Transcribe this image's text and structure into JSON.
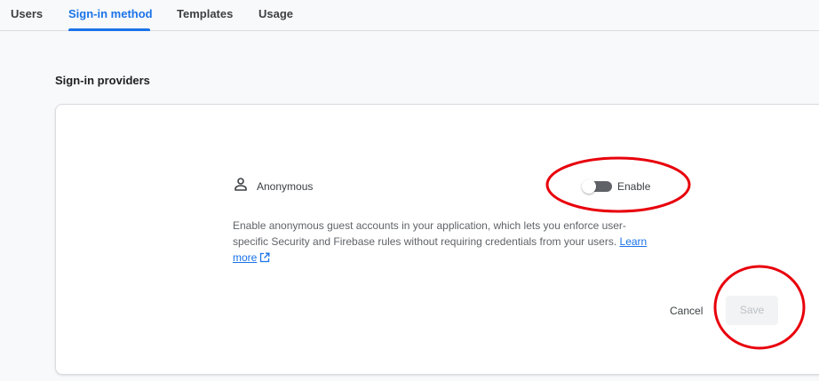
{
  "tabs": [
    {
      "label": "Users",
      "active": false
    },
    {
      "label": "Sign-in method",
      "active": true
    },
    {
      "label": "Templates",
      "active": false
    },
    {
      "label": "Usage",
      "active": false
    }
  ],
  "section": {
    "title": "Sign-in providers"
  },
  "provider": {
    "icon": "person-icon",
    "name": "Anonymous",
    "toggle_label": "Enable",
    "enabled": false,
    "description": "Enable anonymous guest accounts in your application, which lets you enforce user-specific Security and Firebase rules without requiring credentials from your users.",
    "learn_more": "Learn more",
    "learn_more_icon": "open-in-new-icon"
  },
  "actions": {
    "cancel_label": "Cancel",
    "save_label": "Save",
    "save_disabled": true
  },
  "colors": {
    "accent": "#1a73e8",
    "annotation": "#e8000b"
  }
}
